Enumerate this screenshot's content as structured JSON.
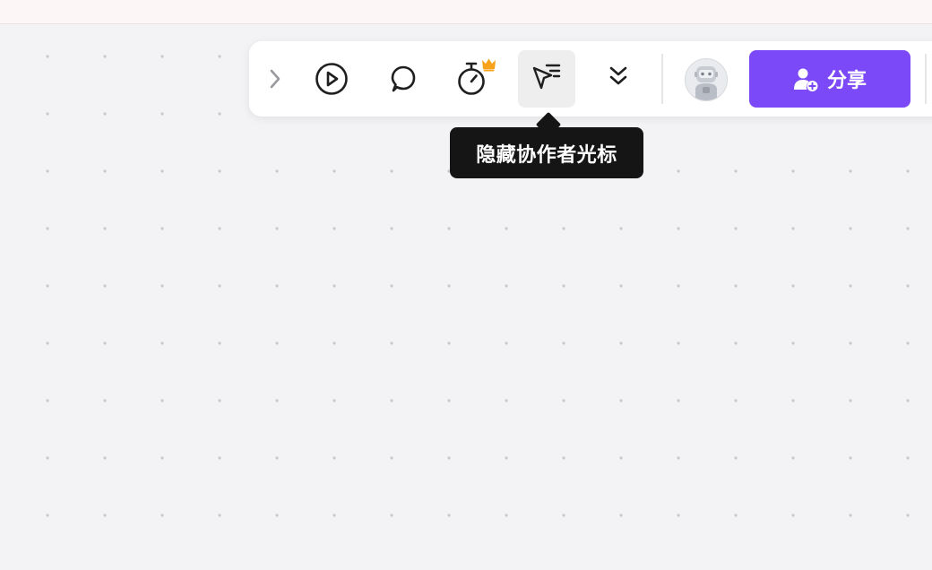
{
  "colors": {
    "canvas_bg": "#f3f3f5",
    "dot": "#c9c9cd",
    "share_button": "#7b49f7",
    "tooltip_bg": "#151515",
    "crown": "#f7a21b"
  },
  "toolbar": {
    "icons": {
      "collapse": "chevron-right-icon",
      "present": "play-circle-icon",
      "comment": "speech-bubble-icon",
      "timer": "stopwatch-icon",
      "premium": "crown-icon",
      "cursor": "cursor-filter-icon",
      "more": "double-chevron-down-icon",
      "share": "user-add-icon"
    },
    "share_label": "分享",
    "avatar_icon": "robot-avatar"
  },
  "tooltip": {
    "text": "隐藏协作者光标"
  }
}
